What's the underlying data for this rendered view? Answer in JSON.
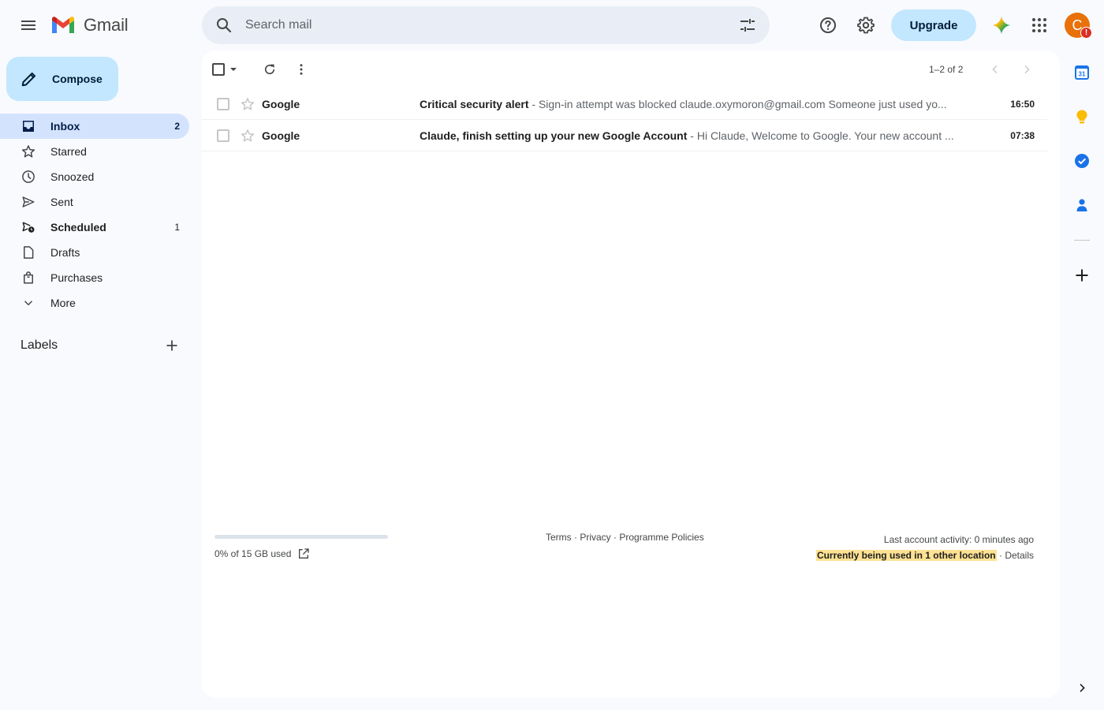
{
  "app": {
    "name": "Gmail",
    "colors": {
      "accent": "#c2e7ff",
      "active_nav": "#d3e3fd",
      "highlight": "#fde293",
      "avatar": "#e8710a",
      "alert": "#d93025"
    }
  },
  "header": {
    "search_placeholder": "Search mail",
    "upgrade_label": "Upgrade",
    "avatar_initial": "C",
    "avatar_alert": "!",
    "icons": [
      "menu-icon",
      "search-icon",
      "tune-icon",
      "help-icon",
      "settings-icon",
      "gemini-icon",
      "apps-icon"
    ]
  },
  "sidebar": {
    "compose_label": "Compose",
    "items": [
      {
        "label": "Inbox",
        "count": "2",
        "icon": "inbox-icon"
      },
      {
        "label": "Starred",
        "count": "",
        "icon": "star-icon"
      },
      {
        "label": "Snoozed",
        "count": "",
        "icon": "clock-icon"
      },
      {
        "label": "Sent",
        "count": "",
        "icon": "send-icon"
      },
      {
        "label": "Scheduled",
        "count": "1",
        "icon": "scheduled-send-icon"
      },
      {
        "label": "Drafts",
        "count": "",
        "icon": "draft-icon"
      },
      {
        "label": "Purchases",
        "count": "",
        "icon": "shopping-bag-icon"
      },
      {
        "label": "More",
        "count": "",
        "icon": "chevron-down-icon"
      }
    ],
    "labels_title": "Labels"
  },
  "toolbar": {
    "pagination": "1–2 of 2"
  },
  "emails": [
    {
      "sender": "Google",
      "subject": "Critical security alert",
      "snippet": " - Sign-in attempt was blocked claude.oxymoron@gmail.com Someone just used yo...",
      "time": "16:50"
    },
    {
      "sender": "Google",
      "subject": "Claude, finish setting up your new Google Account",
      "snippet": " - Hi Claude, Welcome to Google. Your new account ...",
      "time": "07:38"
    }
  ],
  "footer": {
    "storage_text": "0% of 15 GB used",
    "storage_percent": 0,
    "link_terms": "Terms",
    "link_privacy": "Privacy",
    "link_policies": "Programme Policies",
    "separator": " · ",
    "last_activity": "Last account activity: 0 minutes ago",
    "location_notice": "Currently being used in 1 other location",
    "details_link": "Details"
  },
  "side_panel": {
    "calendar_day": "31",
    "icons": [
      "calendar-icon",
      "keep-icon",
      "tasks-icon",
      "contacts-icon",
      "add-addon-icon",
      "expand-panel-icon"
    ]
  }
}
